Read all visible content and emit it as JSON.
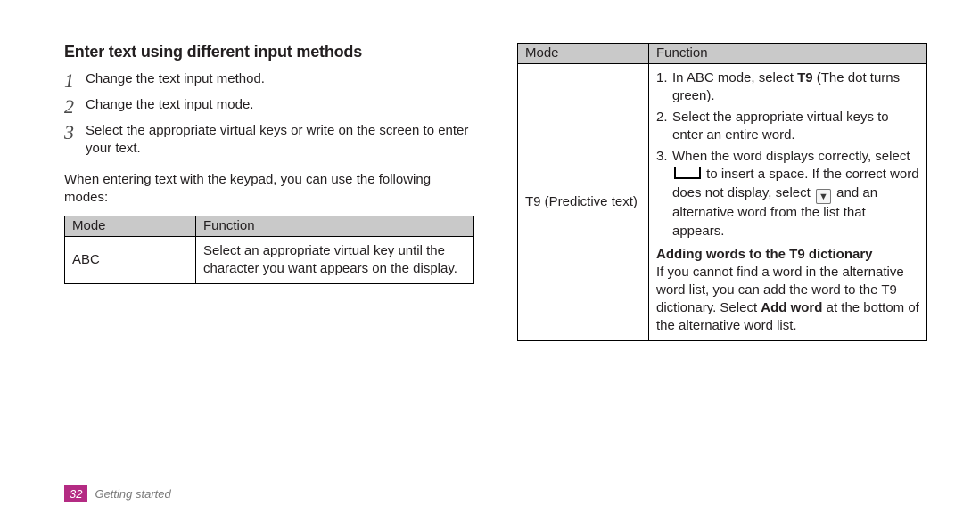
{
  "left": {
    "section_title": "Enter text using different input methods",
    "steps": [
      "Change the text input method.",
      "Change the text input mode.",
      "Select the appropriate virtual keys or write on the screen to enter your text."
    ],
    "intro": "When entering text with the keypad, you can use the following modes:",
    "table": {
      "head_mode": "Mode",
      "head_function": "Function",
      "row1_mode": "ABC",
      "row1_function": "Select an appropriate virtual key until the character you want appears on the display."
    }
  },
  "right": {
    "table": {
      "head_mode": "Mode",
      "head_function": "Function",
      "t9_label": "T9 (Predictive text)",
      "li1_a": "In ABC mode, select ",
      "li1_b": "T9",
      "li1_c": " (The dot turns green).",
      "li2": "Select the appropriate virtual keys to enter an entire word.",
      "li3_a": "When the word displays correctly, select ",
      "li3_b": " to insert a space. If the correct word does not display, select ",
      "li3_c": " and an alternative word from the list that appears.",
      "add_title": "Adding words to the T9 dictionary",
      "add_body_a": "If you cannot find a word in the alternative word list, you can add the word to the T9 dictionary. Select ",
      "add_body_b": "Add word",
      "add_body_c": " at the bottom of the alternative word list."
    }
  },
  "footer": {
    "page_number": "32",
    "section": "Getting started"
  }
}
